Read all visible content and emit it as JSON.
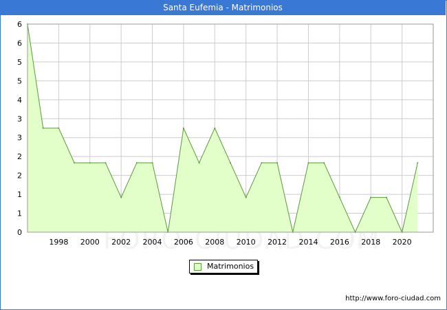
{
  "header": {
    "title": "Santa Eufemia - Matrimonios"
  },
  "watermark": "FORO-CIUDAD.COM",
  "source_url": "http://www.foro-ciudad.com",
  "colors": {
    "title_bar": "#3a78d6",
    "area_fill": "#e2fec9",
    "line": "#5a9a3a"
  },
  "chart_data": {
    "type": "area",
    "title": "Santa Eufemia - Matrimonios",
    "xlabel": "",
    "ylabel": "",
    "x": [
      1996,
      1997,
      1998,
      1999,
      2000,
      2001,
      2002,
      2003,
      2004,
      2005,
      2006,
      2007,
      2008,
      2009,
      2010,
      2011,
      2012,
      2013,
      2014,
      2015,
      2016,
      2017,
      2018,
      2019,
      2020,
      2021
    ],
    "series": [
      {
        "name": "Matrimonios",
        "values": [
          6,
          3,
          3,
          2,
          2,
          2,
          1,
          2,
          2,
          0,
          3,
          2,
          3,
          2,
          1,
          2,
          2,
          0,
          2,
          2,
          1,
          0,
          1,
          1,
          0,
          2
        ]
      }
    ],
    "x_ticks": [
      "1998",
      "2000",
      "2002",
      "2004",
      "2006",
      "2008",
      "2010",
      "2012",
      "2014",
      "2016",
      "2018",
      "2020"
    ],
    "y_ticks": [
      "0",
      "1",
      "1",
      "2",
      "2",
      "3",
      "3",
      "4",
      "5",
      "5",
      "6",
      "6"
    ],
    "xlim": [
      1996,
      2022
    ],
    "ylim": [
      0,
      6
    ],
    "grid": true,
    "legend": "bottom-center"
  }
}
